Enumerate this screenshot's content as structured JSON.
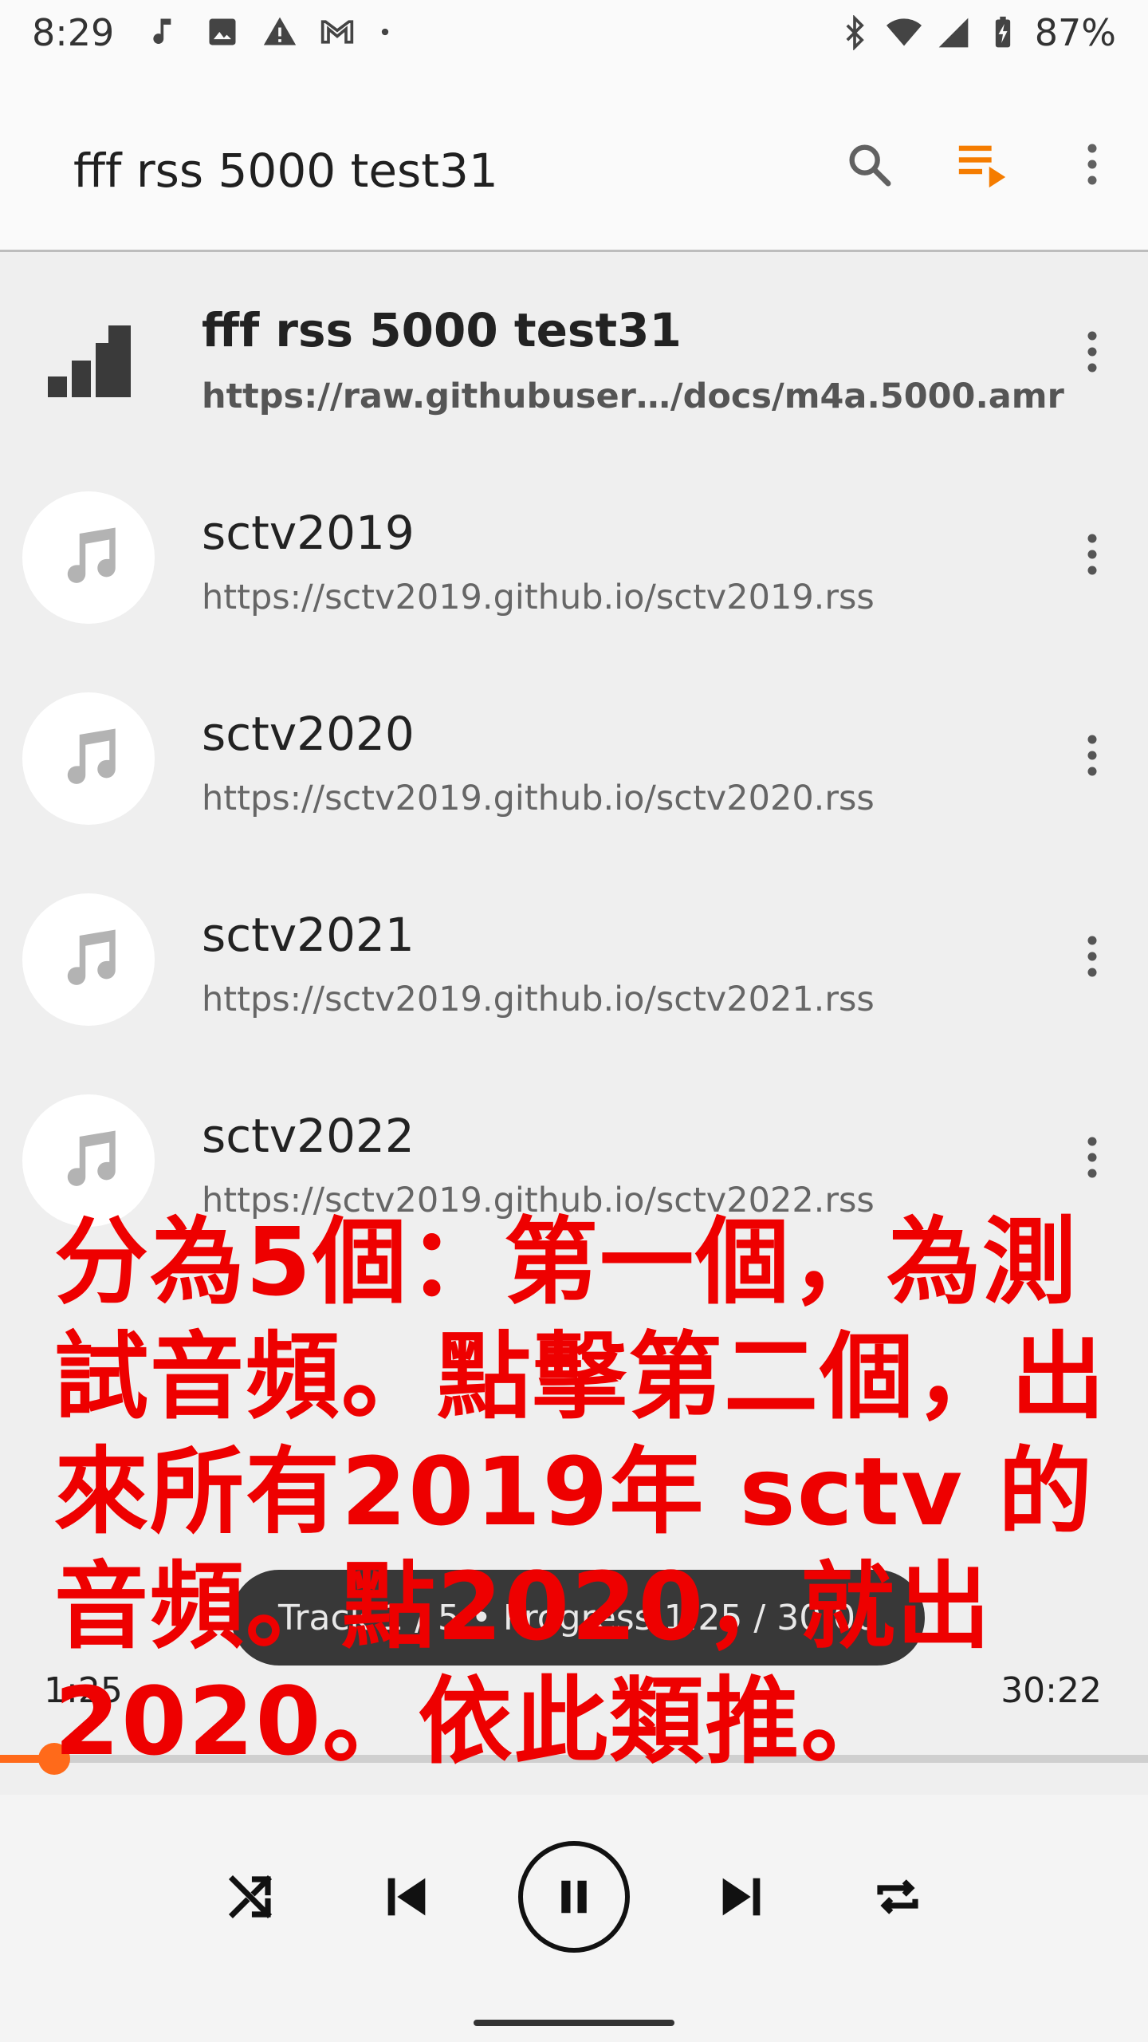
{
  "status_bar": {
    "time": "8:29",
    "battery": "87%",
    "icons": [
      "music-notification-icon",
      "image-notification-icon",
      "warning-icon",
      "gmail-icon",
      "dot-icon",
      "bluetooth-icon",
      "wifi-icon",
      "signal-icon",
      "battery-icon"
    ]
  },
  "appbar": {
    "title": "fff rss 5000 test31",
    "actions": [
      "search-icon",
      "queue-icon",
      "more-vert-icon"
    ],
    "accent": "#f57c00"
  },
  "list": {
    "items": [
      {
        "name": "fff rss 5000 test31",
        "url": "https://raw.githubuser…/docs/m4a.5000.amr",
        "icon": "signal-bars-icon",
        "active": true
      },
      {
        "name": "sctv2019",
        "url": "https://sctv2019.github.io/sctv2019.rss",
        "icon": "music-note-icon"
      },
      {
        "name": "sctv2020",
        "url": "https://sctv2019.github.io/sctv2020.rss",
        "icon": "music-note-icon"
      },
      {
        "name": "sctv2021",
        "url": "https://sctv2019.github.io/sctv2021.rss",
        "icon": "music-note-icon"
      },
      {
        "name": "sctv2022",
        "url": "https://sctv2019.github.io/sctv2022.rss",
        "icon": "music-note-icon"
      }
    ]
  },
  "annotation": {
    "text": "分為5個：第一個，為測試音頻。點擊第二個，出來所有2019年 sctv 的音頻。點2020，就出2020。依此類推。",
    "color": "#ee0000"
  },
  "toast": {
    "text": "Track 1 / 5 • Progress 1:25 / 30:00"
  },
  "player": {
    "elapsed": "1:25",
    "duration": "30:22",
    "progress": 0.047,
    "accent": "#ff6a1a",
    "controls": [
      "shuffle-icon",
      "previous-icon",
      "pause-icon",
      "next-icon",
      "repeat-icon"
    ]
  }
}
